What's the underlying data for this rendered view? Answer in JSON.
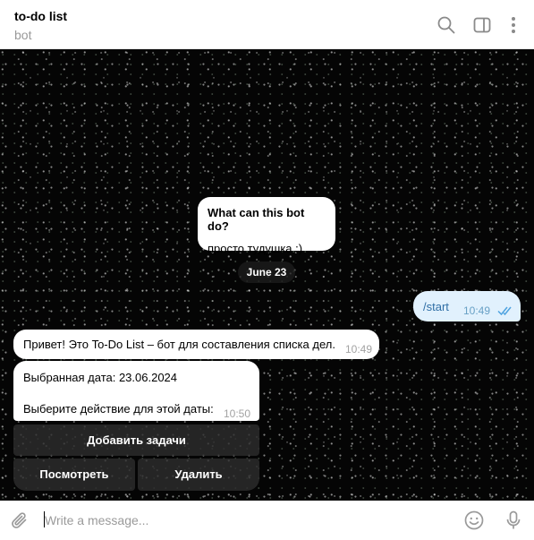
{
  "header": {
    "title": "to-do list",
    "subtitle": "bot",
    "icons": [
      "search-icon",
      "sidebar-toggle-icon",
      "more-vertical-icon"
    ]
  },
  "intro": {
    "question": "What can this bot do?",
    "answer": "просто тудушка :)"
  },
  "date_separator": "June 23",
  "outgoing": {
    "text": "/start",
    "time": "10:49",
    "status_icon": "double-check-icon"
  },
  "incoming": [
    {
      "text": "Привет! Это To-Do List – бот для составления списка дел.",
      "time": "10:49"
    },
    {
      "line1": "Выбранная дата: 23.06.2024",
      "line2": "Выберите действие для этой даты:",
      "time": "10:50"
    }
  ],
  "keyboard": {
    "add": "Добавить задачи",
    "view": "Посмотреть",
    "delete": "Удалить"
  },
  "composer": {
    "placeholder": "Write a message...",
    "icons": [
      "attach-icon",
      "emoji-icon",
      "microphone-icon"
    ]
  },
  "colors": {
    "outgoing_bubble": "#e1f1fd",
    "accent": "#2f6ea5",
    "chat_background": "#050505"
  }
}
